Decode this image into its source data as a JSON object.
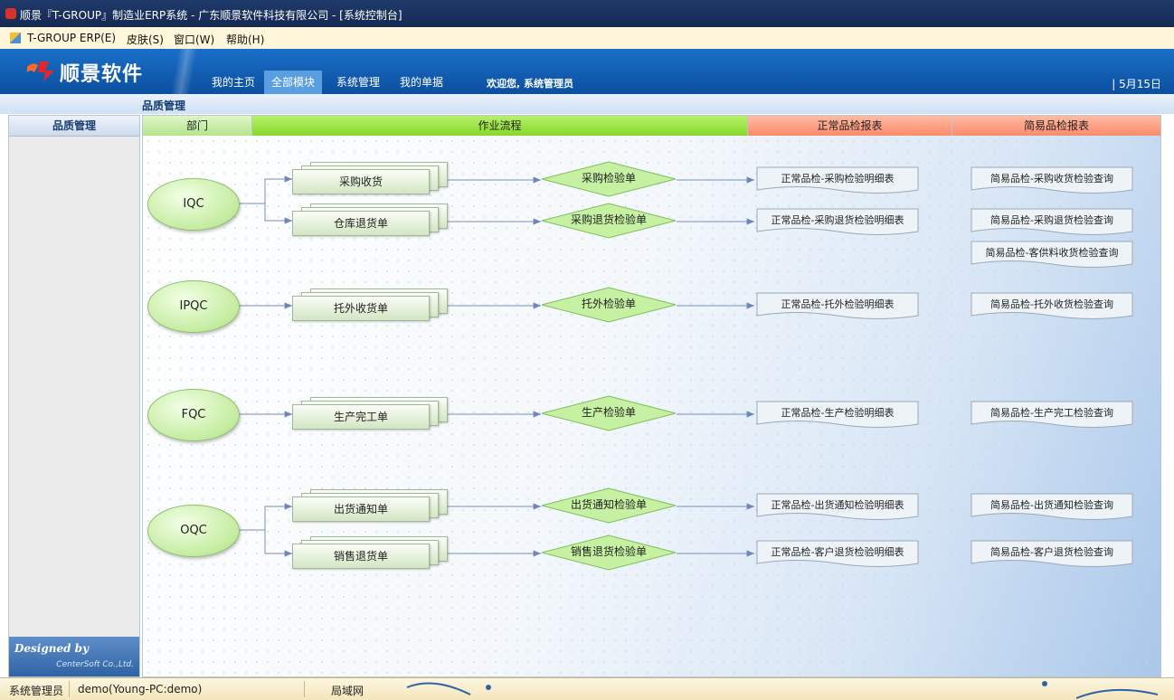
{
  "window": {
    "title": "顺景『T-GROUP』制造业ERP系统 - 广东顺景软件科技有限公司 - [系统控制台]"
  },
  "menu": {
    "items": [
      "T-GROUP ERP(E)",
      "皮肤(S)",
      "窗口(W)",
      "帮助(H)"
    ]
  },
  "header": {
    "logo": "顺景软件",
    "tabs": [
      "我的主页",
      "全部模块",
      "系统管理",
      "我的单据"
    ],
    "active_tab": "全部模块",
    "welcome": "欢迎您, 系统管理员",
    "date": "| 5月15日"
  },
  "breadcrumb": "品质管理",
  "sidebar": {
    "title": "品质管理",
    "designed_by": "Designed by",
    "company": "CenterSoft Co.,Ltd."
  },
  "columns": {
    "dept": "部门",
    "flow": "作业流程",
    "normal": "正常品检报表",
    "simple": "简易品检报表"
  },
  "departments": [
    "IQC",
    "IPQC",
    "FQC",
    "OQC"
  ],
  "documents": [
    "采购收货",
    "仓库退货单",
    "托外收货单",
    "生产完工单",
    "出货通知单",
    "销售退货单"
  ],
  "inspections": [
    "采购检验单",
    "采购退货检验单",
    "托外检验单",
    "生产检验单",
    "出货通知检验单",
    "销售退货检验单"
  ],
  "normal_reports": [
    "正常品检-采购检验明细表",
    "正常品检-采购退货检验明细表",
    "正常品检-托外检验明细表",
    "正常品检-生产检验明细表",
    "正常品检-出货通知检验明细表",
    "正常品检-客户退货检验明细表"
  ],
  "simple_reports": [
    "简易品检-采购收货检验查询",
    "简易品检-采购退货检验查询",
    "简易品检-客供料收货检验查询",
    "简易品检-托外收货检验查询",
    "简易品检-生产完工检验查询",
    "简易品检-出货通知检验查询",
    "简易品检-客户退货检验查询"
  ],
  "status": {
    "user": "系统管理员",
    "connection": "demo(Young-PC:demo)",
    "network": "局域网"
  },
  "colors": {
    "header_blue": "#0c4f9f",
    "flow_green": "#86d82a",
    "report_red": "#fb8a6a"
  }
}
